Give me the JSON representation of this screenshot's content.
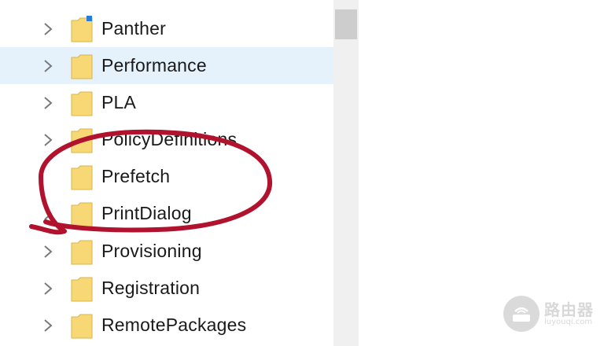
{
  "tree": {
    "items": [
      {
        "label": "Panther",
        "selected": false,
        "icon": "folder-icon"
      },
      {
        "label": "Performance",
        "selected": true,
        "icon": "folder-icon"
      },
      {
        "label": "PLA",
        "selected": false,
        "icon": "folder-icon"
      },
      {
        "label": "PolicyDefinitions",
        "selected": false,
        "icon": "folder-icon"
      },
      {
        "label": "Prefetch",
        "selected": false,
        "icon": "folder-icon"
      },
      {
        "label": "PrintDialog",
        "selected": false,
        "icon": "folder-icon"
      },
      {
        "label": "Provisioning",
        "selected": false,
        "icon": "folder-icon"
      },
      {
        "label": "Registration",
        "selected": false,
        "icon": "folder-icon"
      },
      {
        "label": "RemotePackages",
        "selected": false,
        "icon": "folder-icon"
      }
    ]
  },
  "colors": {
    "selection": "#e5f1fb",
    "folder": "#f8d775",
    "annotation": "#b1122e"
  },
  "watermark": {
    "text": "路由器",
    "sub": "luyouqi.com"
  }
}
